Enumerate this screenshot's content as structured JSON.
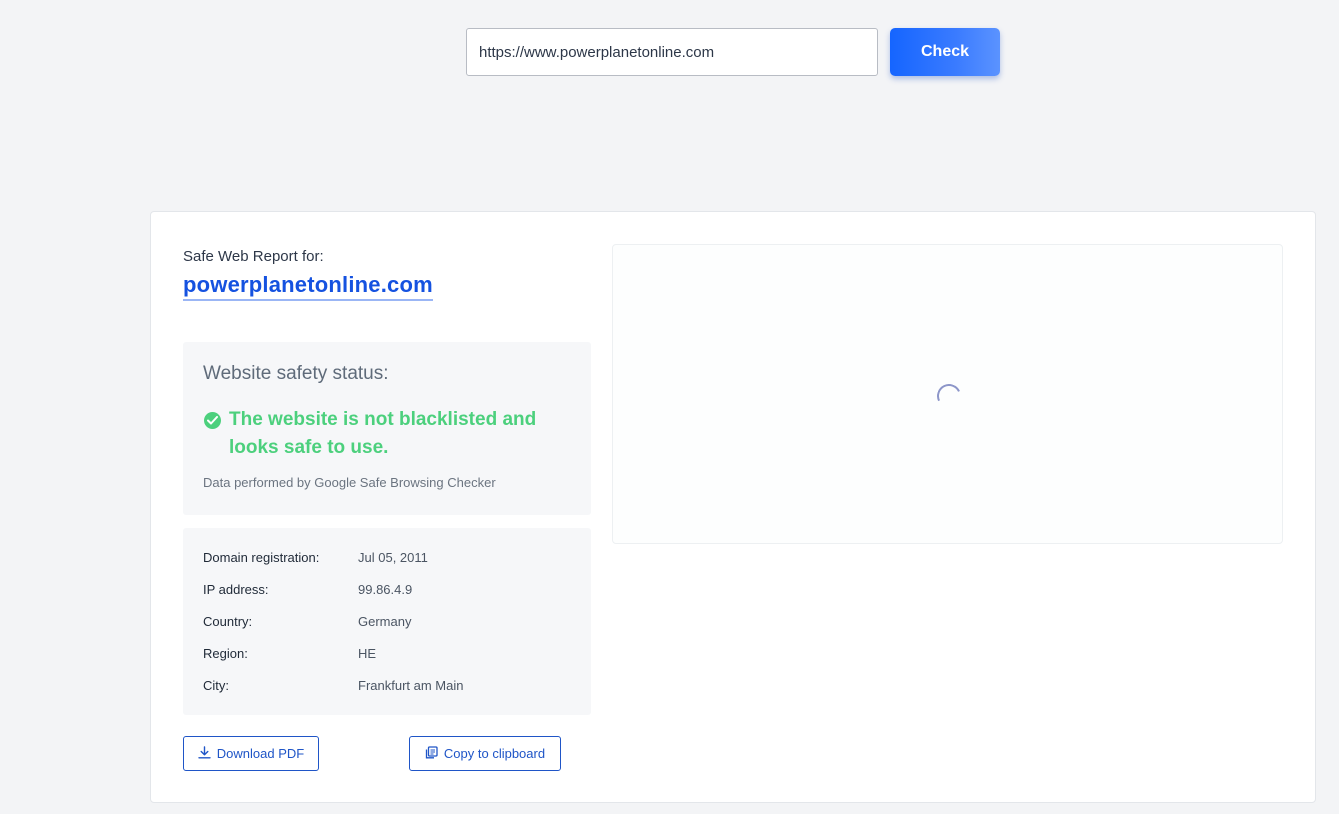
{
  "search": {
    "url_value": "https://www.powerplanetonline.com",
    "check_label": "Check"
  },
  "report": {
    "label": "Safe Web Report for:",
    "domain": "powerplanetonline.com",
    "safety": {
      "title": "Website safety status:",
      "status": "The website is not blacklisted and looks safe to use.",
      "source": "Data performed by Google Safe Browsing Checker",
      "status_color": "#4cd07d"
    },
    "info": [
      {
        "key": "Domain registration:",
        "value": "Jul 05, 2011"
      },
      {
        "key": "IP address:",
        "value": "99.86.4.9"
      },
      {
        "key": "Country:",
        "value": "Germany"
      },
      {
        "key": "Region:",
        "value": "HE"
      },
      {
        "key": "City:",
        "value": "Frankfurt am Main"
      }
    ],
    "actions": {
      "download_label": "Download PDF",
      "copy_label": "Copy to clipboard"
    }
  },
  "colors": {
    "accent": "#1565ff",
    "link": "#1552e0",
    "background": "#f3f4f6"
  }
}
